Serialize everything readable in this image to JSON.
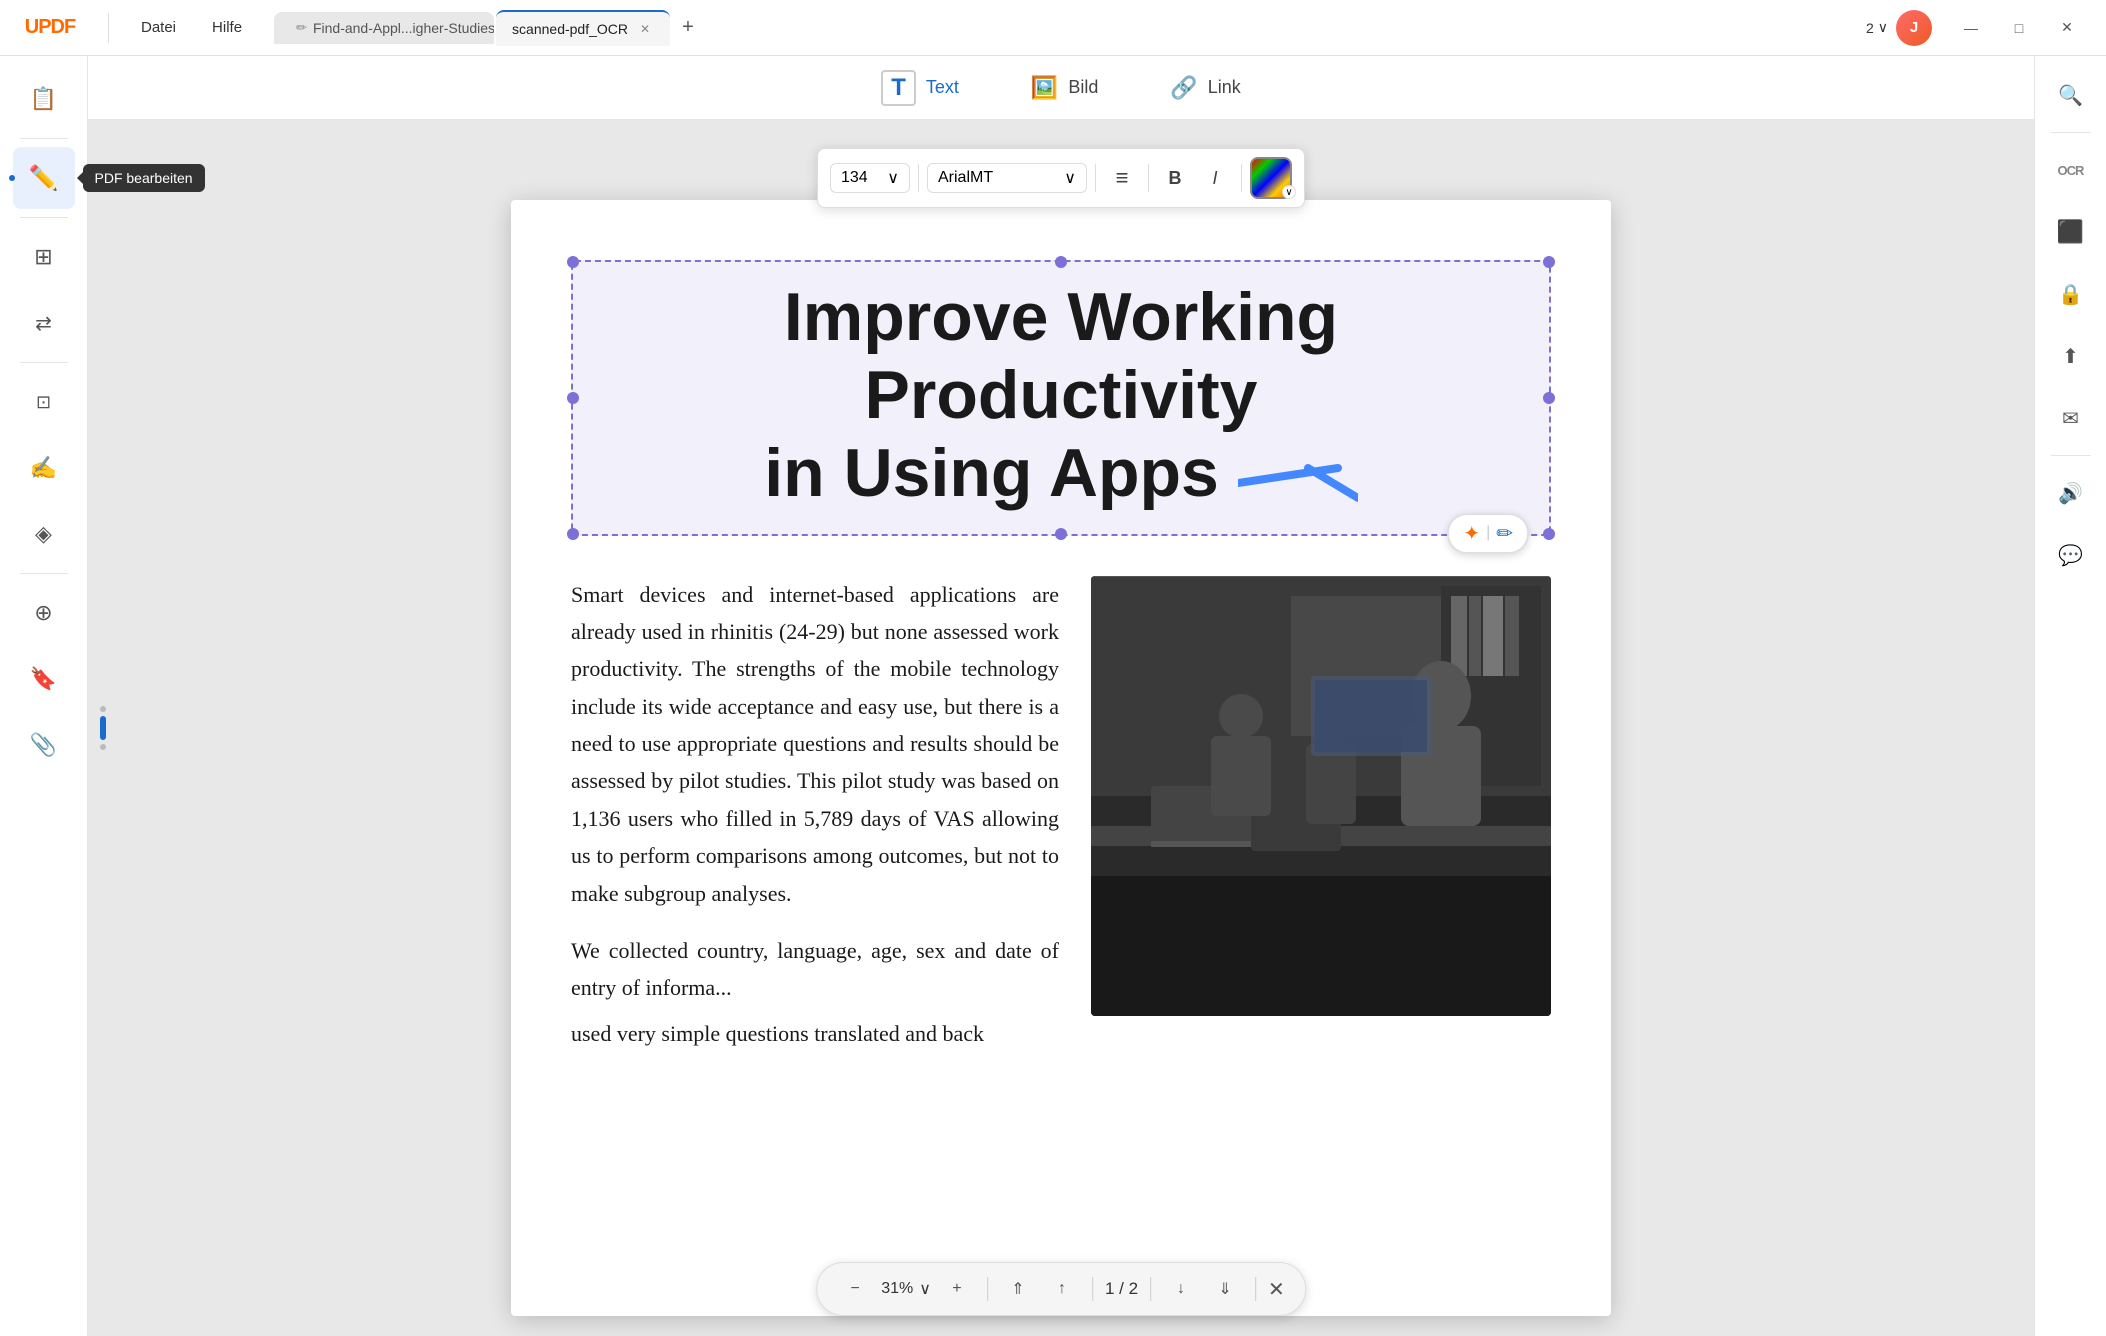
{
  "app": {
    "logo": "UPDF",
    "logo_accent": "U"
  },
  "titlebar": {
    "menu_items": [
      "Datei",
      "Hilfe"
    ],
    "tabs": [
      {
        "id": "tab1",
        "label": "Find-and-Appl...igher-Studies",
        "active": false,
        "has_edit_icon": true
      },
      {
        "id": "tab2",
        "label": "scanned-pdf_OCR",
        "active": true,
        "has_edit_icon": false
      }
    ],
    "page_nav": "2",
    "page_nav_chevron": "∨",
    "user_initial": "J",
    "win_minimize": "—",
    "win_maximize": "□",
    "win_close": "✕"
  },
  "left_sidebar": {
    "items": [
      {
        "id": "view-pages",
        "icon": "☰",
        "label": "",
        "tooltip": ""
      },
      {
        "id": "separator1"
      },
      {
        "id": "edit-pdf",
        "icon": "✏️",
        "label": "",
        "tooltip": "PDF bearbeiten",
        "active": true,
        "show_tooltip": true
      },
      {
        "id": "separator2"
      },
      {
        "id": "organize",
        "icon": "⊞",
        "label": ""
      },
      {
        "id": "convert",
        "icon": "⇄",
        "label": ""
      },
      {
        "id": "separator3"
      },
      {
        "id": "ocr",
        "icon": "⊡",
        "label": ""
      },
      {
        "id": "signature",
        "icon": "✍",
        "label": ""
      },
      {
        "id": "stamp",
        "icon": "◈",
        "label": ""
      },
      {
        "id": "separator4"
      },
      {
        "id": "layers",
        "icon": "⊕",
        "label": ""
      },
      {
        "id": "bookmark",
        "icon": "🔖",
        "label": ""
      },
      {
        "id": "attachment",
        "icon": "📎",
        "label": ""
      }
    ]
  },
  "top_toolbar": {
    "items": [
      {
        "id": "text-tool",
        "icon": "T",
        "label": "Text",
        "active": true
      },
      {
        "id": "image-tool",
        "icon": "🖼",
        "label": "Bild"
      },
      {
        "id": "link-tool",
        "icon": "🔗",
        "label": "Link"
      }
    ]
  },
  "format_toolbar": {
    "font_size": "134",
    "font_name": "ArialMT",
    "align_icon": "≡",
    "bold": "B",
    "italic": "I",
    "color": "#000000",
    "color_gradient": [
      "#ff0000",
      "#00ff00",
      "#0000ff",
      "#ffff00"
    ]
  },
  "right_sidebar": {
    "items": [
      {
        "id": "search",
        "icon": "🔍"
      },
      {
        "id": "separator1"
      },
      {
        "id": "ocr-right",
        "icon": "OCR"
      },
      {
        "id": "redact",
        "icon": "⬛"
      },
      {
        "id": "protect",
        "icon": "🔒"
      },
      {
        "id": "share",
        "icon": "⬆"
      },
      {
        "id": "send",
        "icon": "✉"
      },
      {
        "id": "separator2"
      },
      {
        "id": "speaker",
        "icon": "🔊"
      },
      {
        "id": "chat",
        "icon": "💬"
      }
    ]
  },
  "document": {
    "title_line1": "Improve Working Productivity",
    "title_line2": "in Using Apps",
    "body_text": "Smart devices and internet-based applications are already used in rhinitis (24-29) but none assessed work productivity. The strengths of the mobile technology include its wide acceptance and easy use, but there is a need to use appropriate questions and results should be assessed by pilot studies. This pilot study was based on 1,136 users who filled in 5,789 days of VAS allowing us to perform comparisons among outcomes, but not to make subgroup analyses.\nWe collected country, language, age, sex and date of entry of informa...\nused very simple questions translated and back",
    "page_indicator": "1 / 2"
  },
  "bottom_bar": {
    "zoom_out": "−",
    "zoom_value": "31%",
    "zoom_in": "+",
    "up_fast": "⇑",
    "up": "↑",
    "divider": "|",
    "page_info": "1 / 2",
    "down": "↓",
    "down_fast": "⇓",
    "close": "✕"
  },
  "ai_button": {
    "sparkle": "✦",
    "edit": "✏"
  },
  "tooltip": {
    "text": "PDF bearbeiten"
  }
}
